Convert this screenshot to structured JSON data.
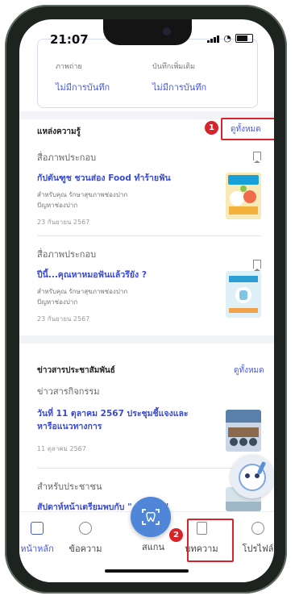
{
  "status": {
    "time": "21:07"
  },
  "summary": {
    "left_label": "ภาพถ่าย",
    "right_label": "บันทึกเพิ่มเติม",
    "left_value": "ไม่มีการบันทึก",
    "right_value": "ไม่มีการบันทึก"
  },
  "knowledge": {
    "title": "แหล่งความรู้",
    "see_all": "ดูทั้งหมด",
    "badge": "1",
    "items": [
      {
        "category": "สื่อภาพประกอบ",
        "title": "กัปตันฑูช ชวนส่อง Food ทำร้ายฟัน",
        "meta1": "สำหรับคุณ  รักษาสุขภาพช่องปาก",
        "meta2": "ปัญหาช่องปาก",
        "date": "23 กันยายน 2567"
      },
      {
        "category": "สื่อภาพประกอบ",
        "title": "ปีนี้...คุณหาหมอฟันแล้วรึยัง ?",
        "meta1": "สำหรับคุณ  รักษาสุขภาพช่องปาก",
        "meta2": "ปัญหาช่องปาก",
        "date": "23 กันยายน 2567"
      }
    ]
  },
  "news": {
    "title": "ข่าวสารประชาสัมพันธ์",
    "see_all": "ดูทั้งหมด",
    "items": [
      {
        "category": "ข่าวสารกิจกรรม",
        "title": "วันที่ 11 ตุลาคม 2567 ประชุมชี้แจงและหารือแนวทางการ",
        "date": "11 ตุลาคม 2567"
      },
      {
        "category": "สำหรับประชาชน",
        "title": "สัปดาห์หน้าเตรียมพบกับ \"...ฟันสุข\""
      }
    ]
  },
  "tabbar": {
    "home": "หน้าหลัก",
    "messages": "ข้อความ",
    "scan": "สแกน",
    "articles": "บทความ",
    "profile": "โปรไฟล์",
    "badge": "2"
  },
  "colors": {
    "accent": "#4a5bd8",
    "highlight": "#d9232a",
    "scan": "#4f86d8"
  }
}
